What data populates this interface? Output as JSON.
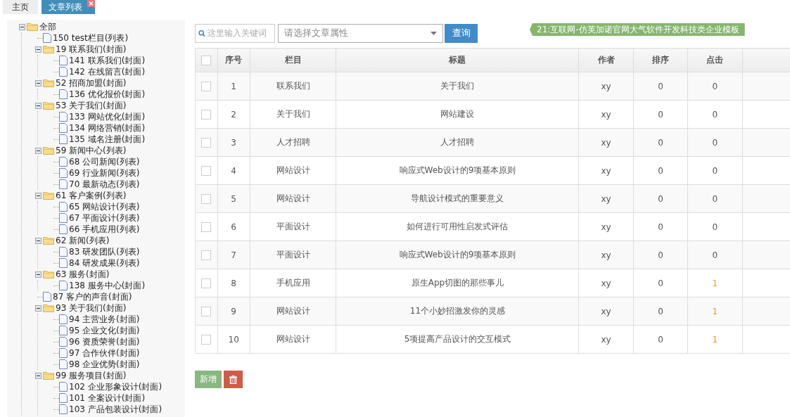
{
  "tabs": [
    {
      "label": "主页",
      "selected": false,
      "closable": false
    },
    {
      "label": "文章列表",
      "selected": true,
      "closable": true
    }
  ],
  "tree": [
    {
      "label": "全部",
      "expanded": true,
      "children": [
        {
          "label": "150 test栏目(列表)"
        },
        {
          "label": "19 联系我们(封面)",
          "expanded": true,
          "children": [
            {
              "label": "141 联系我们(封面)"
            },
            {
              "label": "142 在线留言(封面)"
            }
          ]
        },
        {
          "label": "52 招商加盟(封面)",
          "expanded": true,
          "children": [
            {
              "label": "136 优化报价(封面)"
            }
          ]
        },
        {
          "label": "53 关于我们(封面)",
          "expanded": true,
          "children": [
            {
              "label": "133 网站优化(封面)"
            },
            {
              "label": "134 网络营销(封面)"
            },
            {
              "label": "135 域名注册(封面)"
            }
          ]
        },
        {
          "label": "59 新闻中心(列表)",
          "expanded": true,
          "children": [
            {
              "label": "68 公司新闻(列表)"
            },
            {
              "label": "69 行业新闻(列表)"
            },
            {
              "label": "70 最新动态(列表)"
            }
          ]
        },
        {
          "label": "61 客户案例(列表)",
          "expanded": true,
          "children": [
            {
              "label": "65 网站设计(列表)"
            },
            {
              "label": "67 平面设计(列表)"
            },
            {
              "label": "66 手机应用(列表)"
            }
          ]
        },
        {
          "label": "62 新闻(列表)",
          "expanded": true,
          "children": [
            {
              "label": "83 研发团队(列表)"
            },
            {
              "label": "84 研发成果(列表)"
            }
          ]
        },
        {
          "label": "63 服务(封面)",
          "expanded": true,
          "children": [
            {
              "label": "138 服务中心(封面)"
            }
          ]
        },
        {
          "label": "87 客户的声音(封面)"
        },
        {
          "label": "93 关于我们(封面)",
          "expanded": true,
          "children": [
            {
              "label": "94 主营业务(封面)"
            },
            {
              "label": "95 企业文化(封面)"
            },
            {
              "label": "96 资质荣誉(封面)"
            },
            {
              "label": "97 合作伙伴(封面)"
            },
            {
              "label": "98 企业优势(封面)"
            }
          ]
        },
        {
          "label": "99 服务项目(封面)",
          "expanded": true,
          "children": [
            {
              "label": "102 企业形象设计(封面)"
            },
            {
              "label": "101 全案设计(封面)"
            },
            {
              "label": "103 产品包装设计(封面)"
            }
          ]
        }
      ]
    }
  ],
  "search": {
    "placeholder": "这里输入关键词"
  },
  "attribute_select": {
    "placeholder": "请选择文章属性"
  },
  "query_button": "查询",
  "banner": "21:互联网-仿英加诺官网大气软件开发科技类企业模板",
  "table": {
    "select_all": {
      "checked": false
    },
    "columns": [
      "序号",
      "栏目",
      "标题",
      "作者",
      "排序",
      "点击"
    ],
    "rows": [
      {
        "checked": false,
        "cells": [
          "1",
          "联系我们",
          "关于我们",
          "xy",
          "0",
          "0"
        ],
        "color": "#555555"
      },
      {
        "checked": false,
        "cells": [
          "2",
          "关于我们",
          "网站建设",
          "xy",
          "0",
          "0"
        ],
        "color": "#555555"
      },
      {
        "checked": false,
        "cells": [
          "3",
          "人才招聘",
          "人才招聘",
          "xy",
          "0",
          "0"
        ],
        "color": "#555555"
      },
      {
        "checked": false,
        "cells": [
          "4",
          "网站设计",
          "响应式Web设计的9项基本原则",
          "xy",
          "0",
          "0"
        ],
        "color": "#555555"
      },
      {
        "checked": false,
        "cells": [
          "5",
          "网站设计",
          "导航设计模式的重要意义",
          "xy",
          "0",
          "0"
        ],
        "color": "#555555"
      },
      {
        "checked": false,
        "cells": [
          "6",
          "平面设计",
          "如何进行可用性启发式评估",
          "xy",
          "0",
          "0"
        ],
        "color": "#555555"
      },
      {
        "checked": false,
        "cells": [
          "7",
          "平面设计",
          "响应式Web设计的9项基本原则",
          "xy",
          "0",
          "0"
        ],
        "color": "#555555"
      },
      {
        "checked": false,
        "cells": [
          "8",
          "手机应用",
          "原生App切图的那些事儿",
          "xy",
          "0",
          "1"
        ],
        "color": "#e39b2b"
      },
      {
        "checked": false,
        "cells": [
          "9",
          "网站设计",
          "11个小妙招激发你的灵感",
          "xy",
          "0",
          "1"
        ],
        "color": "#e39b2b"
      },
      {
        "checked": false,
        "cells": [
          "10",
          "网站设计",
          "5项提高产品设计的交互模式",
          "xy",
          "0",
          "1"
        ],
        "color": "#e39b2b"
      }
    ]
  },
  "add_button": "新增"
}
